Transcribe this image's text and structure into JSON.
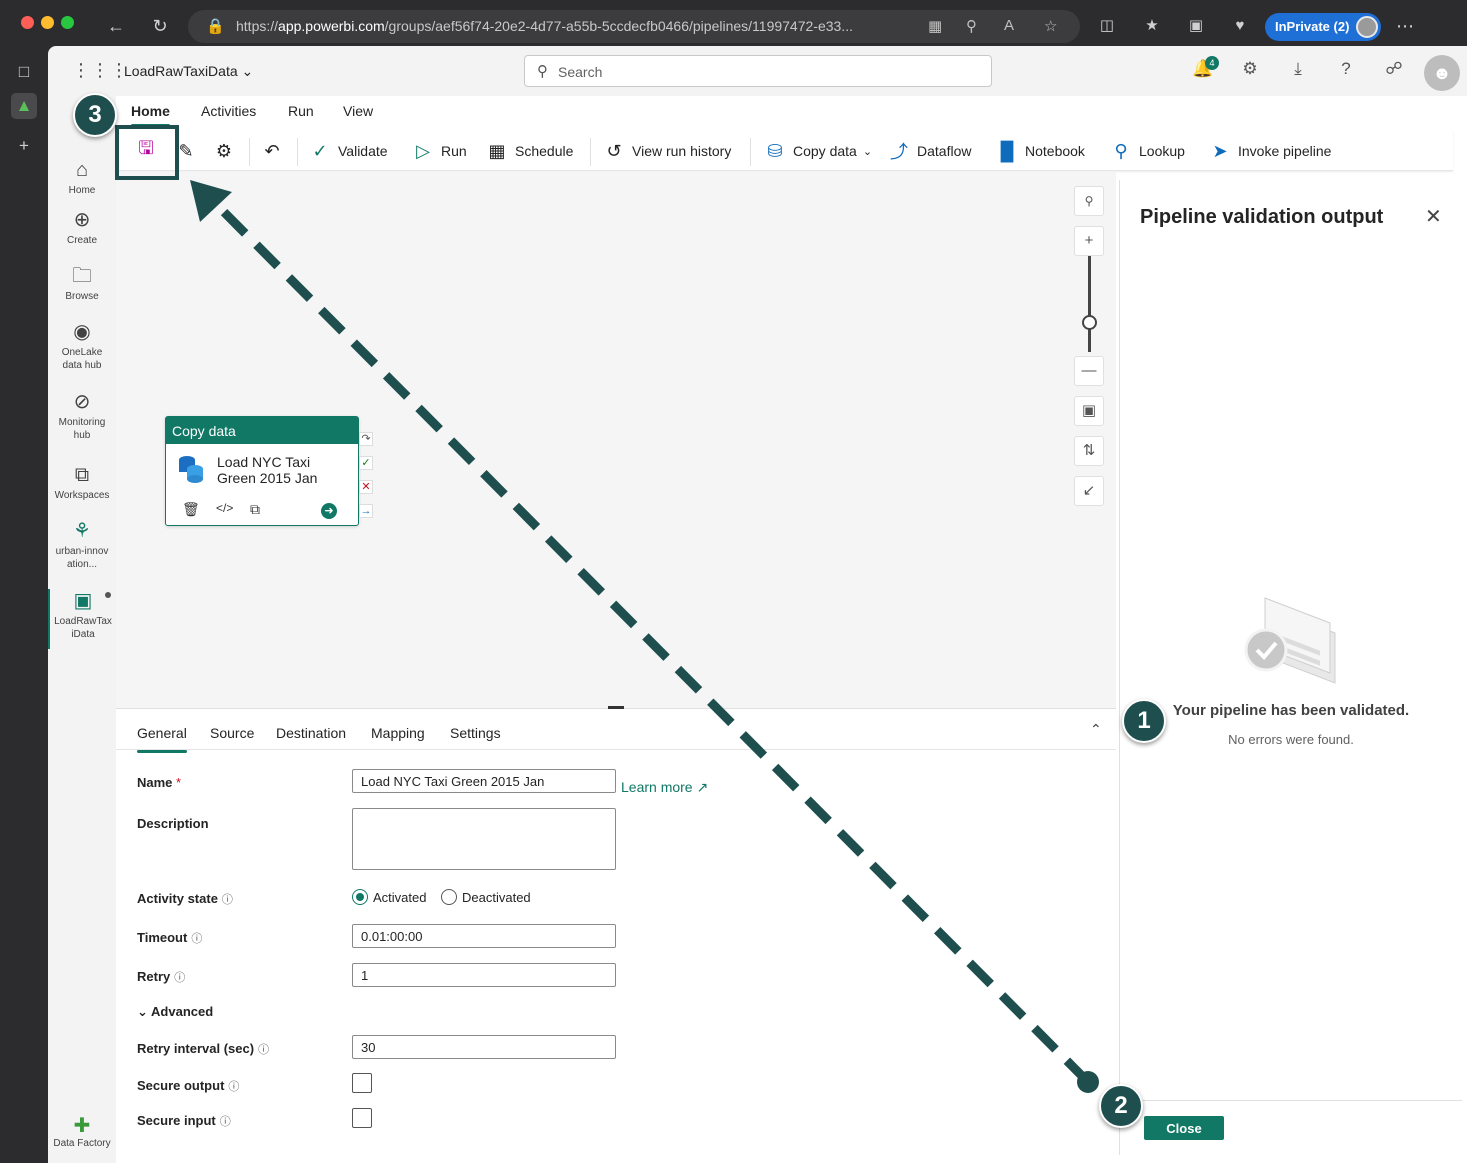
{
  "browser": {
    "url_prefix": "https://",
    "url_host": "app.powerbi.com",
    "url_path": "/groups/aef56f74-20e2-4d77-a55b-5ccdecfb0466/pipelines/11997472-e33...",
    "inprivate_label": "InPrivate (2)"
  },
  "topbar": {
    "workspace_name": "LoadRawTaxiData",
    "search_placeholder": "Search",
    "notification_count": "4"
  },
  "nav": {
    "home": "Home",
    "create": "Create",
    "browse": "Browse",
    "onelake": "OneLake data hub",
    "monitoring": "Monitoring hub",
    "workspaces": "Workspaces",
    "urban": "urban-innovation...",
    "loadraw": "LoadRawTaxiData",
    "footer": "Data Factory"
  },
  "ribbon": {
    "tabs": [
      "Home",
      "Activities",
      "Run",
      "View"
    ],
    "validate": "Validate",
    "run": "Run",
    "schedule": "Schedule",
    "view_run_history": "View run history",
    "copy_data": "Copy data",
    "dataflow": "Dataflow",
    "notebook": "Notebook",
    "lookup": "Lookup",
    "invoke_pipeline": "Invoke pipeline"
  },
  "activity": {
    "type": "Copy data",
    "name": "Load NYC Taxi Green 2015 Jan"
  },
  "properties": {
    "tabs": [
      "General",
      "Source",
      "Destination",
      "Mapping",
      "Settings"
    ],
    "name_label": "Name",
    "name_required": "*",
    "name_value": "Load NYC Taxi Green 2015 Jan",
    "learn_more": "Learn more",
    "description_label": "Description",
    "activity_state_label": "Activity state",
    "activated": "Activated",
    "deactivated": "Deactivated",
    "timeout_label": "Timeout",
    "timeout_value": "0.01:00:00",
    "retry_label": "Retry",
    "retry_value": "1",
    "advanced_label": "Advanced",
    "retry_interval_label": "Retry interval (sec)",
    "retry_interval_value": "30",
    "secure_output_label": "Secure output",
    "secure_input_label": "Secure input"
  },
  "validation": {
    "title": "Pipeline validation output",
    "message": "Your pipeline has been validated.",
    "sub": "No errors were found.",
    "close_button": "Close"
  },
  "callouts": [
    "1",
    "2",
    "3"
  ],
  "colors": {
    "accent": "#117865",
    "annotation": "#1f4e4e"
  }
}
